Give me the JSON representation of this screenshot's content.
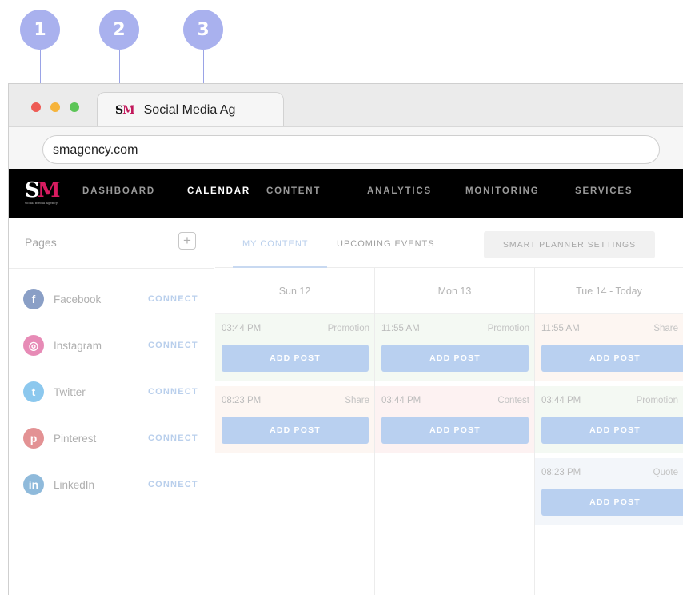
{
  "callouts": [
    "1",
    "2",
    "3"
  ],
  "browser": {
    "tab_title": "Social Media Ag",
    "tab_logo": "SM",
    "url": "smagency.com",
    "traffic_colors": [
      "#ee5b55",
      "#f6b43b",
      "#5cc557"
    ]
  },
  "app": {
    "logo": "SM",
    "logo_tagline": "social media agency",
    "nav": [
      "DASHBOARD",
      "CALENDAR",
      "CONTENT",
      "ANALYTICS",
      "MONITORING",
      "SERVICES"
    ],
    "active_nav": "CALENDAR"
  },
  "sidebar": {
    "title": "Pages",
    "add_icon": "plus-icon",
    "pages": [
      {
        "name": "Facebook",
        "action": "CONNECT",
        "icon": "facebook-icon",
        "color": "#8a9fc6",
        "glyph": "f"
      },
      {
        "name": "Instagram",
        "action": "CONNECT",
        "icon": "instagram-icon",
        "color": "#e78bb6",
        "glyph": "◎"
      },
      {
        "name": "Twitter",
        "action": "CONNECT",
        "icon": "twitter-icon",
        "color": "#8cc8ee",
        "glyph": "t"
      },
      {
        "name": "Pinterest",
        "action": "CONNECT",
        "icon": "pinterest-icon",
        "color": "#e39294",
        "glyph": "p"
      },
      {
        "name": "LinkedIn",
        "action": "CONNECT",
        "icon": "linkedin-icon",
        "color": "#8fbadb",
        "glyph": "in"
      }
    ]
  },
  "calendar": {
    "tabs": [
      "MY CONTENT",
      "UPCOMING EVENTS"
    ],
    "active_tab": "MY CONTENT",
    "smart_button": "SMART PLANNER SETTINGS",
    "add_post_label": "ADD POST",
    "days": [
      {
        "label": "Sun 12",
        "slots": [
          {
            "time": "03:44 PM",
            "type": "Promotion",
            "bg": "#f4f9f3"
          },
          {
            "time": "08:23 PM",
            "type": "Share",
            "bg": "#fdf6f2"
          }
        ]
      },
      {
        "label": "Mon 13",
        "slots": [
          {
            "time": "11:55 AM",
            "type": "Promotion",
            "bg": "#f4f9f3"
          },
          {
            "time": "03:44 PM",
            "type": "Contest",
            "bg": "#fdf2f2"
          }
        ]
      },
      {
        "label": "Tue 14 - Today",
        "slots": [
          {
            "time": "11:55 AM",
            "type": "Share",
            "bg": "#fdf6f2"
          },
          {
            "time": "03:44 PM",
            "type": "Promotion",
            "bg": "#f4f9f3"
          },
          {
            "time": "08:23 PM",
            "type": "Quote",
            "bg": "#f3f6fa"
          }
        ]
      }
    ]
  }
}
